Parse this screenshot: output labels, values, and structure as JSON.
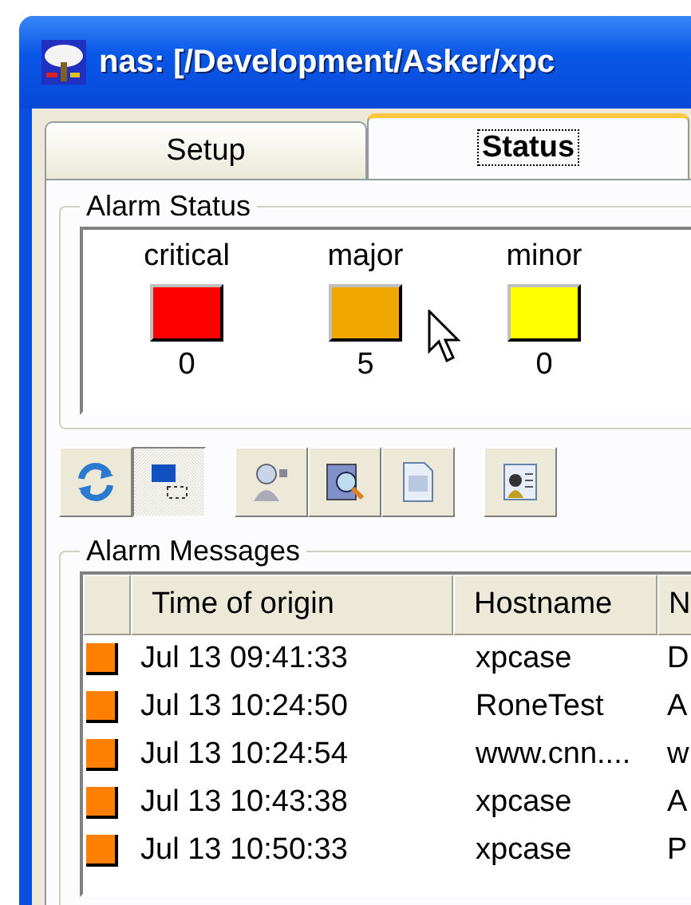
{
  "window": {
    "title": "nas: [/Development/Asker/xpc"
  },
  "tabs": [
    {
      "label": "Setup",
      "selected": false
    },
    {
      "label": "Status",
      "selected": true
    }
  ],
  "alarm_status": {
    "title": "Alarm Status",
    "levels": [
      {
        "label": "critical",
        "color": "#ff0000",
        "count": "0"
      },
      {
        "label": "major",
        "color": "#f0a800",
        "count": "5"
      },
      {
        "label": "minor",
        "color": "#ffff00",
        "count": "0"
      }
    ]
  },
  "toolbar": [
    {
      "kind": "refresh",
      "pressed": false
    },
    {
      "kind": "window",
      "pressed": true
    },
    {
      "kind": "person",
      "pressed": false
    },
    {
      "kind": "search",
      "pressed": false
    },
    {
      "kind": "document",
      "pressed": false
    },
    {
      "kind": "report",
      "pressed": false
    }
  ],
  "alarm_messages": {
    "title": "Alarm Messages",
    "columns": [
      "Time of origin",
      "Hostname",
      "N"
    ],
    "rows": [
      {
        "color": "#ff8000",
        "cells": [
          "Jul 13 09:41:33",
          "xpcase",
          "D"
        ]
      },
      {
        "color": "#ff8000",
        "cells": [
          "Jul 13 10:24:50",
          "RoneTest",
          "A"
        ]
      },
      {
        "color": "#ff8000",
        "cells": [
          "Jul 13 10:24:54",
          "www.cnn....",
          "w"
        ]
      },
      {
        "color": "#ff8000",
        "cells": [
          "Jul 13 10:43:38",
          "xpcase",
          "A"
        ]
      },
      {
        "color": "#ff8000",
        "cells": [
          "Jul 13 10:50:33",
          "xpcase",
          "P"
        ]
      }
    ]
  }
}
